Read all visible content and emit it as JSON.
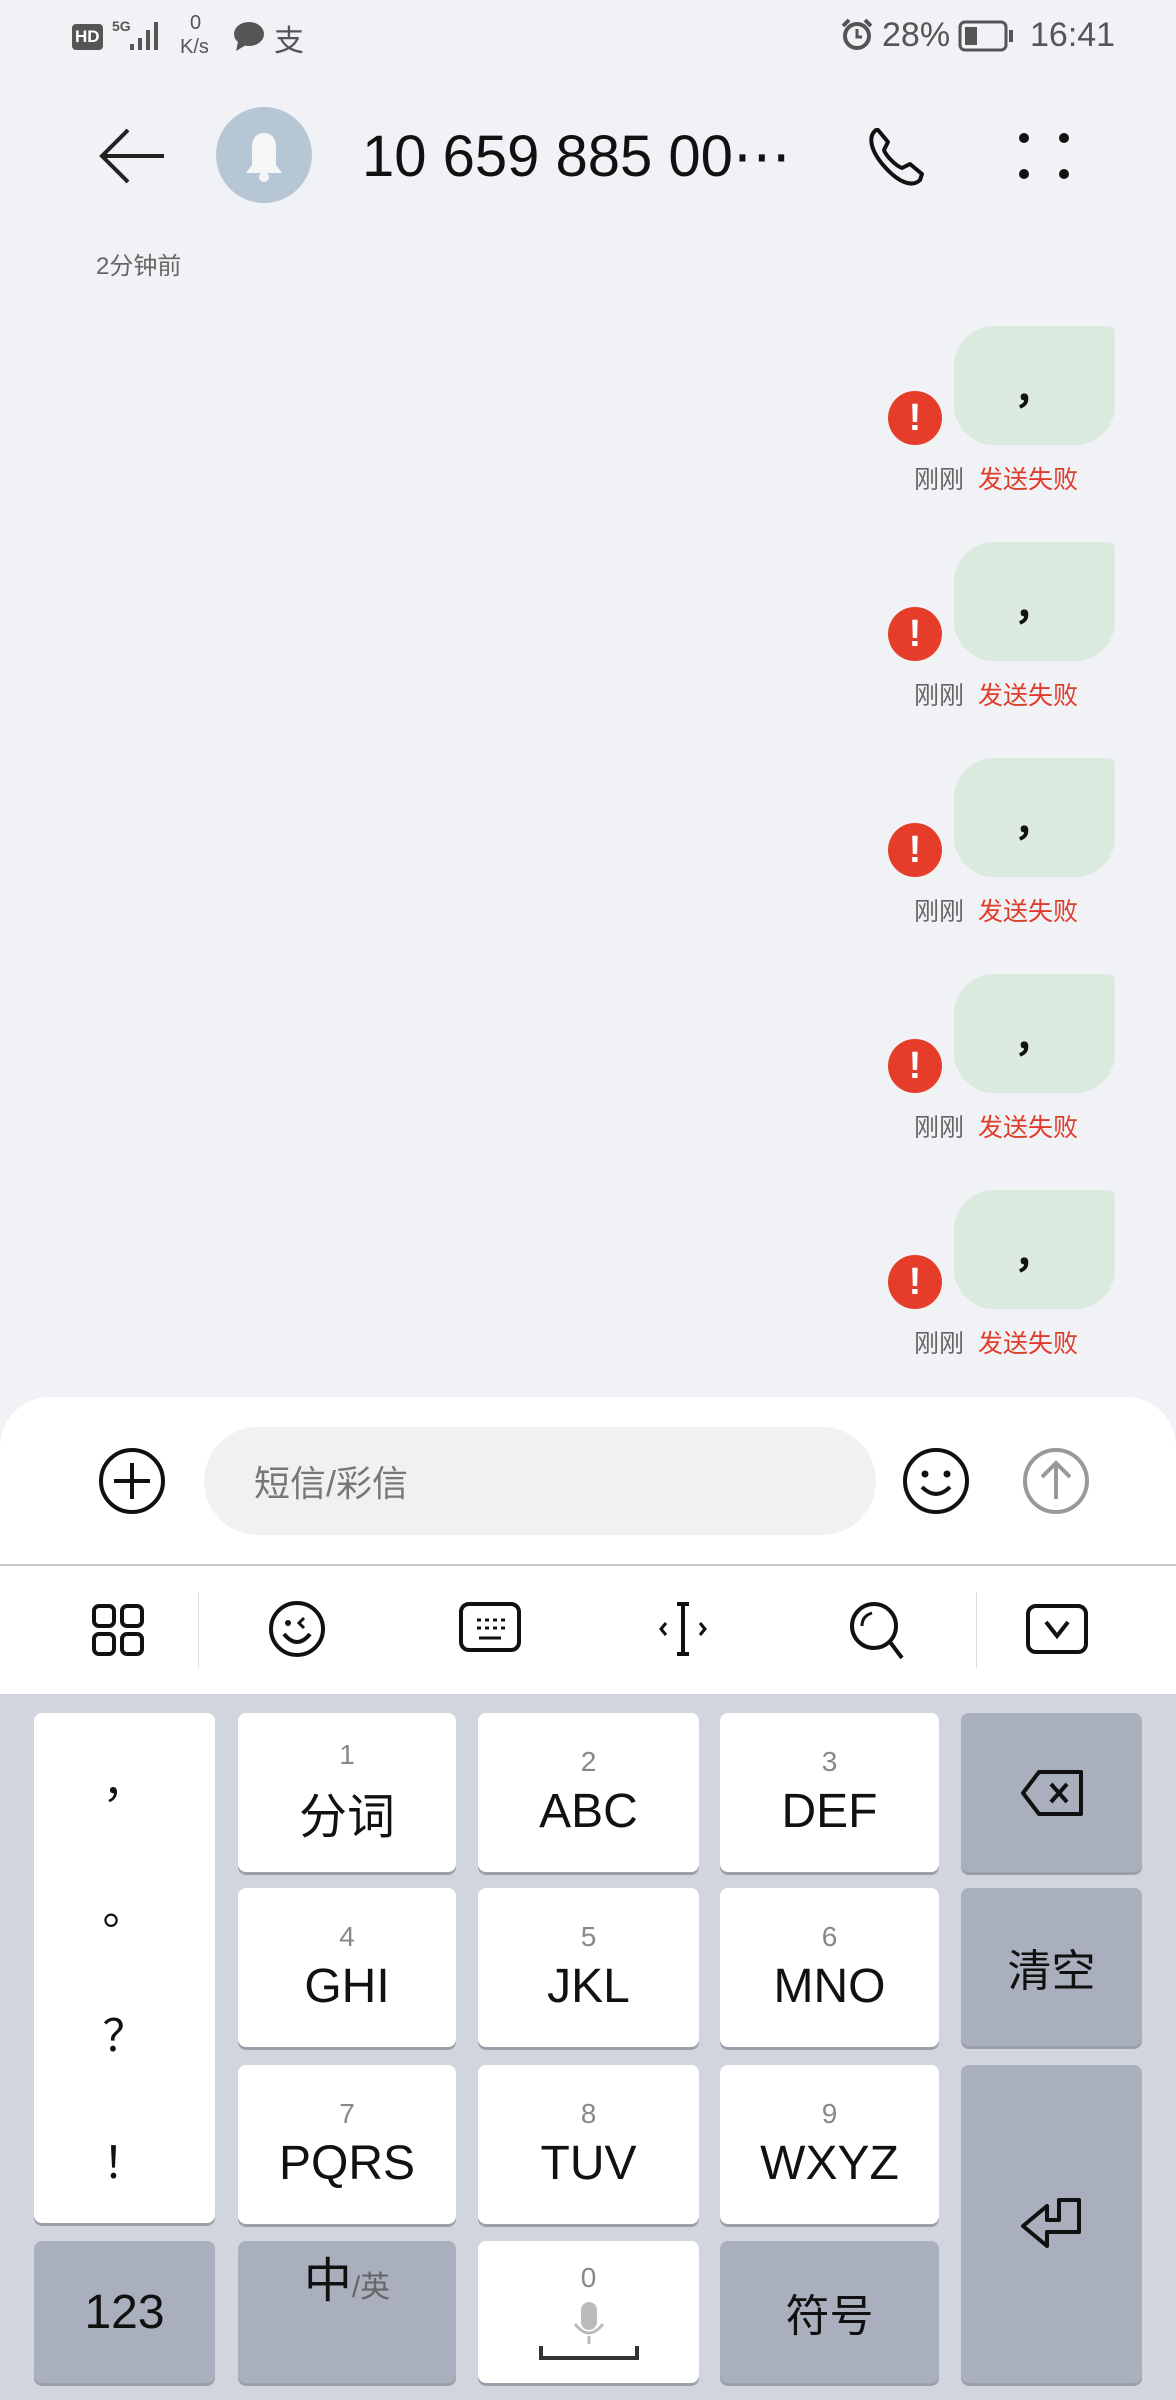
{
  "status_bar": {
    "hd": "HD",
    "network": "5G",
    "speed_value": "0",
    "speed_unit": "K/s",
    "battery": "28%",
    "time": "16:41"
  },
  "header": {
    "title": "10 659 885 00⋯",
    "timestamp": "2分钟前"
  },
  "messages": [
    {
      "text": "，",
      "time": "刚刚",
      "status": "发送失败"
    },
    {
      "text": "，",
      "time": "刚刚",
      "status": "发送失败"
    },
    {
      "text": "，",
      "time": "刚刚",
      "status": "发送失败"
    },
    {
      "text": "，",
      "time": "刚刚",
      "status": "发送失败"
    },
    {
      "text": "，",
      "time": "刚刚",
      "status": "发送失败"
    }
  ],
  "composer": {
    "placeholder": "短信/彩信"
  },
  "keyboard": {
    "punctuation": [
      "，",
      "。",
      "？",
      "！"
    ],
    "keys": [
      {
        "num": "1",
        "label": "分词"
      },
      {
        "num": "2",
        "label": "ABC"
      },
      {
        "num": "3",
        "label": "DEF"
      },
      {
        "num": "4",
        "label": "GHI"
      },
      {
        "num": "5",
        "label": "JKL"
      },
      {
        "num": "6",
        "label": "MNO"
      },
      {
        "num": "7",
        "label": "PQRS"
      },
      {
        "num": "8",
        "label": "TUV"
      },
      {
        "num": "9",
        "label": "WXYZ"
      }
    ],
    "clear": "清空",
    "num_mode": "123",
    "lang_main": "中",
    "lang_alt": "/英",
    "space_num": "0",
    "symbols": "符号"
  },
  "colors": {
    "background": "#f1f2f5",
    "bubble": "#dbeade",
    "error": "#e53d2a",
    "keyboard": "#d1d5de",
    "function_key": "#a9afbc"
  }
}
